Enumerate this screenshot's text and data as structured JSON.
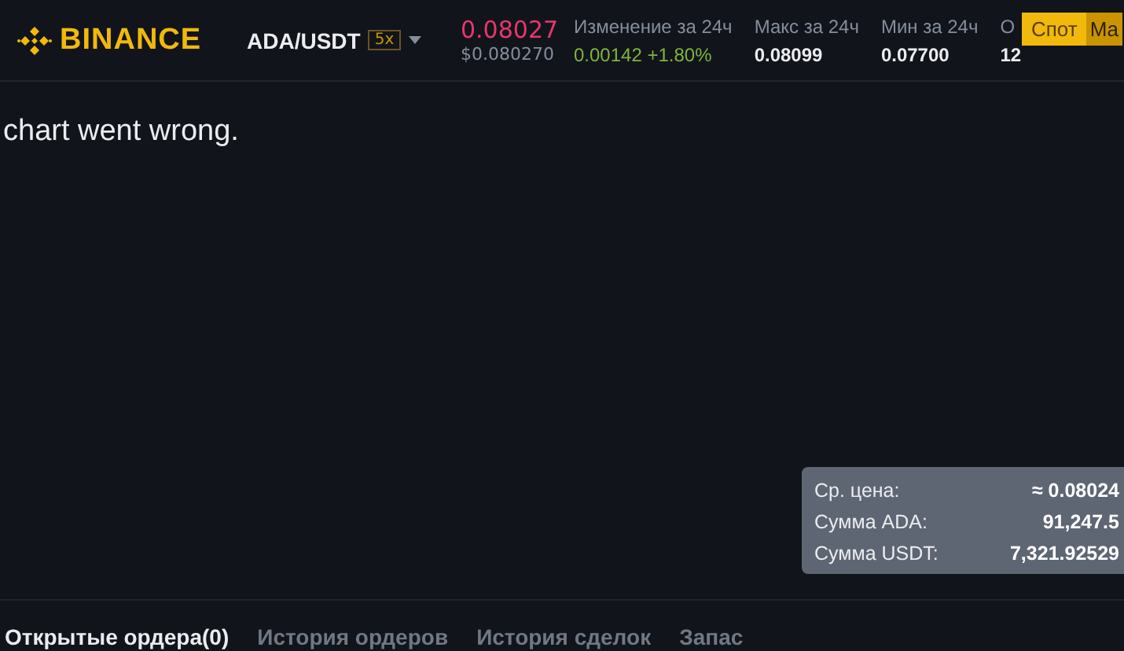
{
  "header": {
    "logo": "BINANCE",
    "pair": "ADA/USDT",
    "leverage": "5x",
    "price": "0.08027",
    "price_usd": "$0.080270",
    "stats": [
      {
        "label": "Изменение за 24ч",
        "value": "0.00142 +1.80%",
        "kind": "up"
      },
      {
        "label": "Макс за 24ч",
        "value": "0.08099",
        "kind": "plain"
      },
      {
        "label": "Мин за 24ч",
        "value": "0.07700",
        "kind": "plain"
      },
      {
        "label": "О",
        "value": "12",
        "kind": "plain"
      }
    ],
    "badge": {
      "label": "Спот",
      "tail": "Ма"
    }
  },
  "chart": {
    "error": "chart went wrong."
  },
  "tooltip": {
    "rows": [
      {
        "label": "Ср. цена:",
        "value": "≈ 0.08024"
      },
      {
        "label": "Сумма ADA:",
        "value": "91,247.5"
      },
      {
        "label": "Сумма USDT:",
        "value": "7,321.92529"
      }
    ]
  },
  "tabs": [
    {
      "label": "Открытые ордера(0)",
      "selected": true
    },
    {
      "label": "История ордеров",
      "selected": false
    },
    {
      "label": "История сделок",
      "selected": false
    },
    {
      "label": "Запас",
      "selected": false
    }
  ]
}
